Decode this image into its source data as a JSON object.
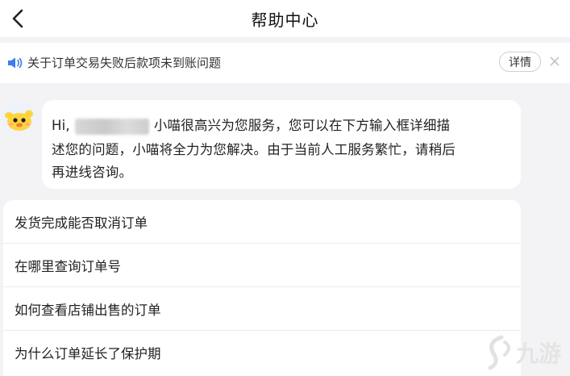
{
  "header": {
    "title": "帮助中心"
  },
  "notice": {
    "text": "关于订单交易失败后款项未到账问题",
    "details_label": "详情"
  },
  "bot_message": {
    "greeting": "Hi,",
    "line1_rest": "小喵很高兴为您服务，您可以在下方输入框详细描",
    "line2": "述您的问题，小喵将全力为您解决。由于当前人工服务繁忙，请稍后",
    "line3": "再进线咨询。"
  },
  "faq": [
    {
      "label": "发货完成能否取消订单"
    },
    {
      "label": "在哪里查询订单号"
    },
    {
      "label": "如何查看店铺出售的订单"
    },
    {
      "label": "为什么订单延长了保护期"
    }
  ],
  "watermark": {
    "text": "九游"
  },
  "icons": {
    "back": "chevron-left-icon",
    "speaker": "speaker-icon",
    "close": "close-icon",
    "avatar": "mascot-avatar-icon"
  }
}
